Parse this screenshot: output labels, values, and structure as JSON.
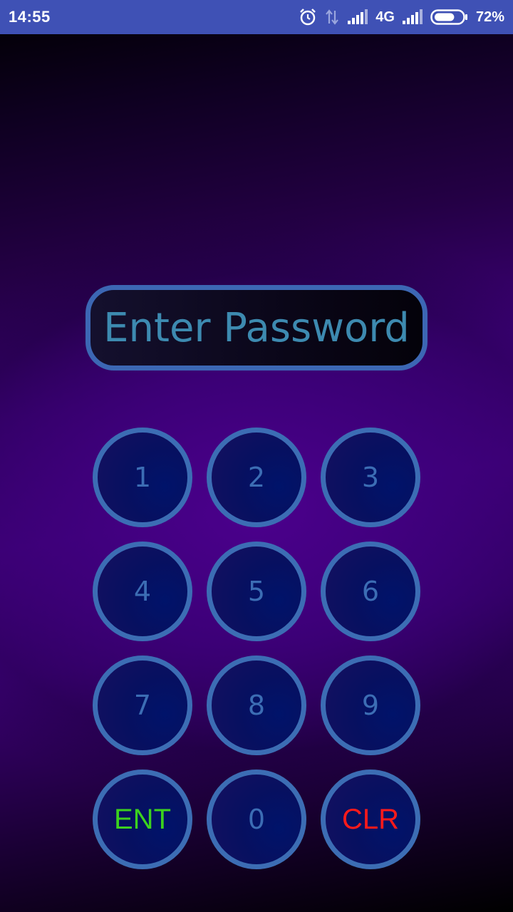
{
  "status_bar": {
    "time": "14:55",
    "network": "4G",
    "battery_percent": "72%",
    "icons": [
      "alarm-icon",
      "data-transfer-icon",
      "signal-icon",
      "signal-icon",
      "battery-icon"
    ],
    "battery_level": 0.72
  },
  "password": {
    "placeholder": "Enter Password",
    "value": ""
  },
  "keypad": {
    "keys": [
      "1",
      "2",
      "3",
      "4",
      "5",
      "6",
      "7",
      "8",
      "9",
      "ENT",
      "0",
      "CLR"
    ]
  },
  "colors": {
    "status_bar": "#3f51b5",
    "outline": "#3c6db4",
    "placeholder_text": "#3d8ab0",
    "enter_key": "#3cd21e",
    "clear_key": "#ff1a1a"
  }
}
